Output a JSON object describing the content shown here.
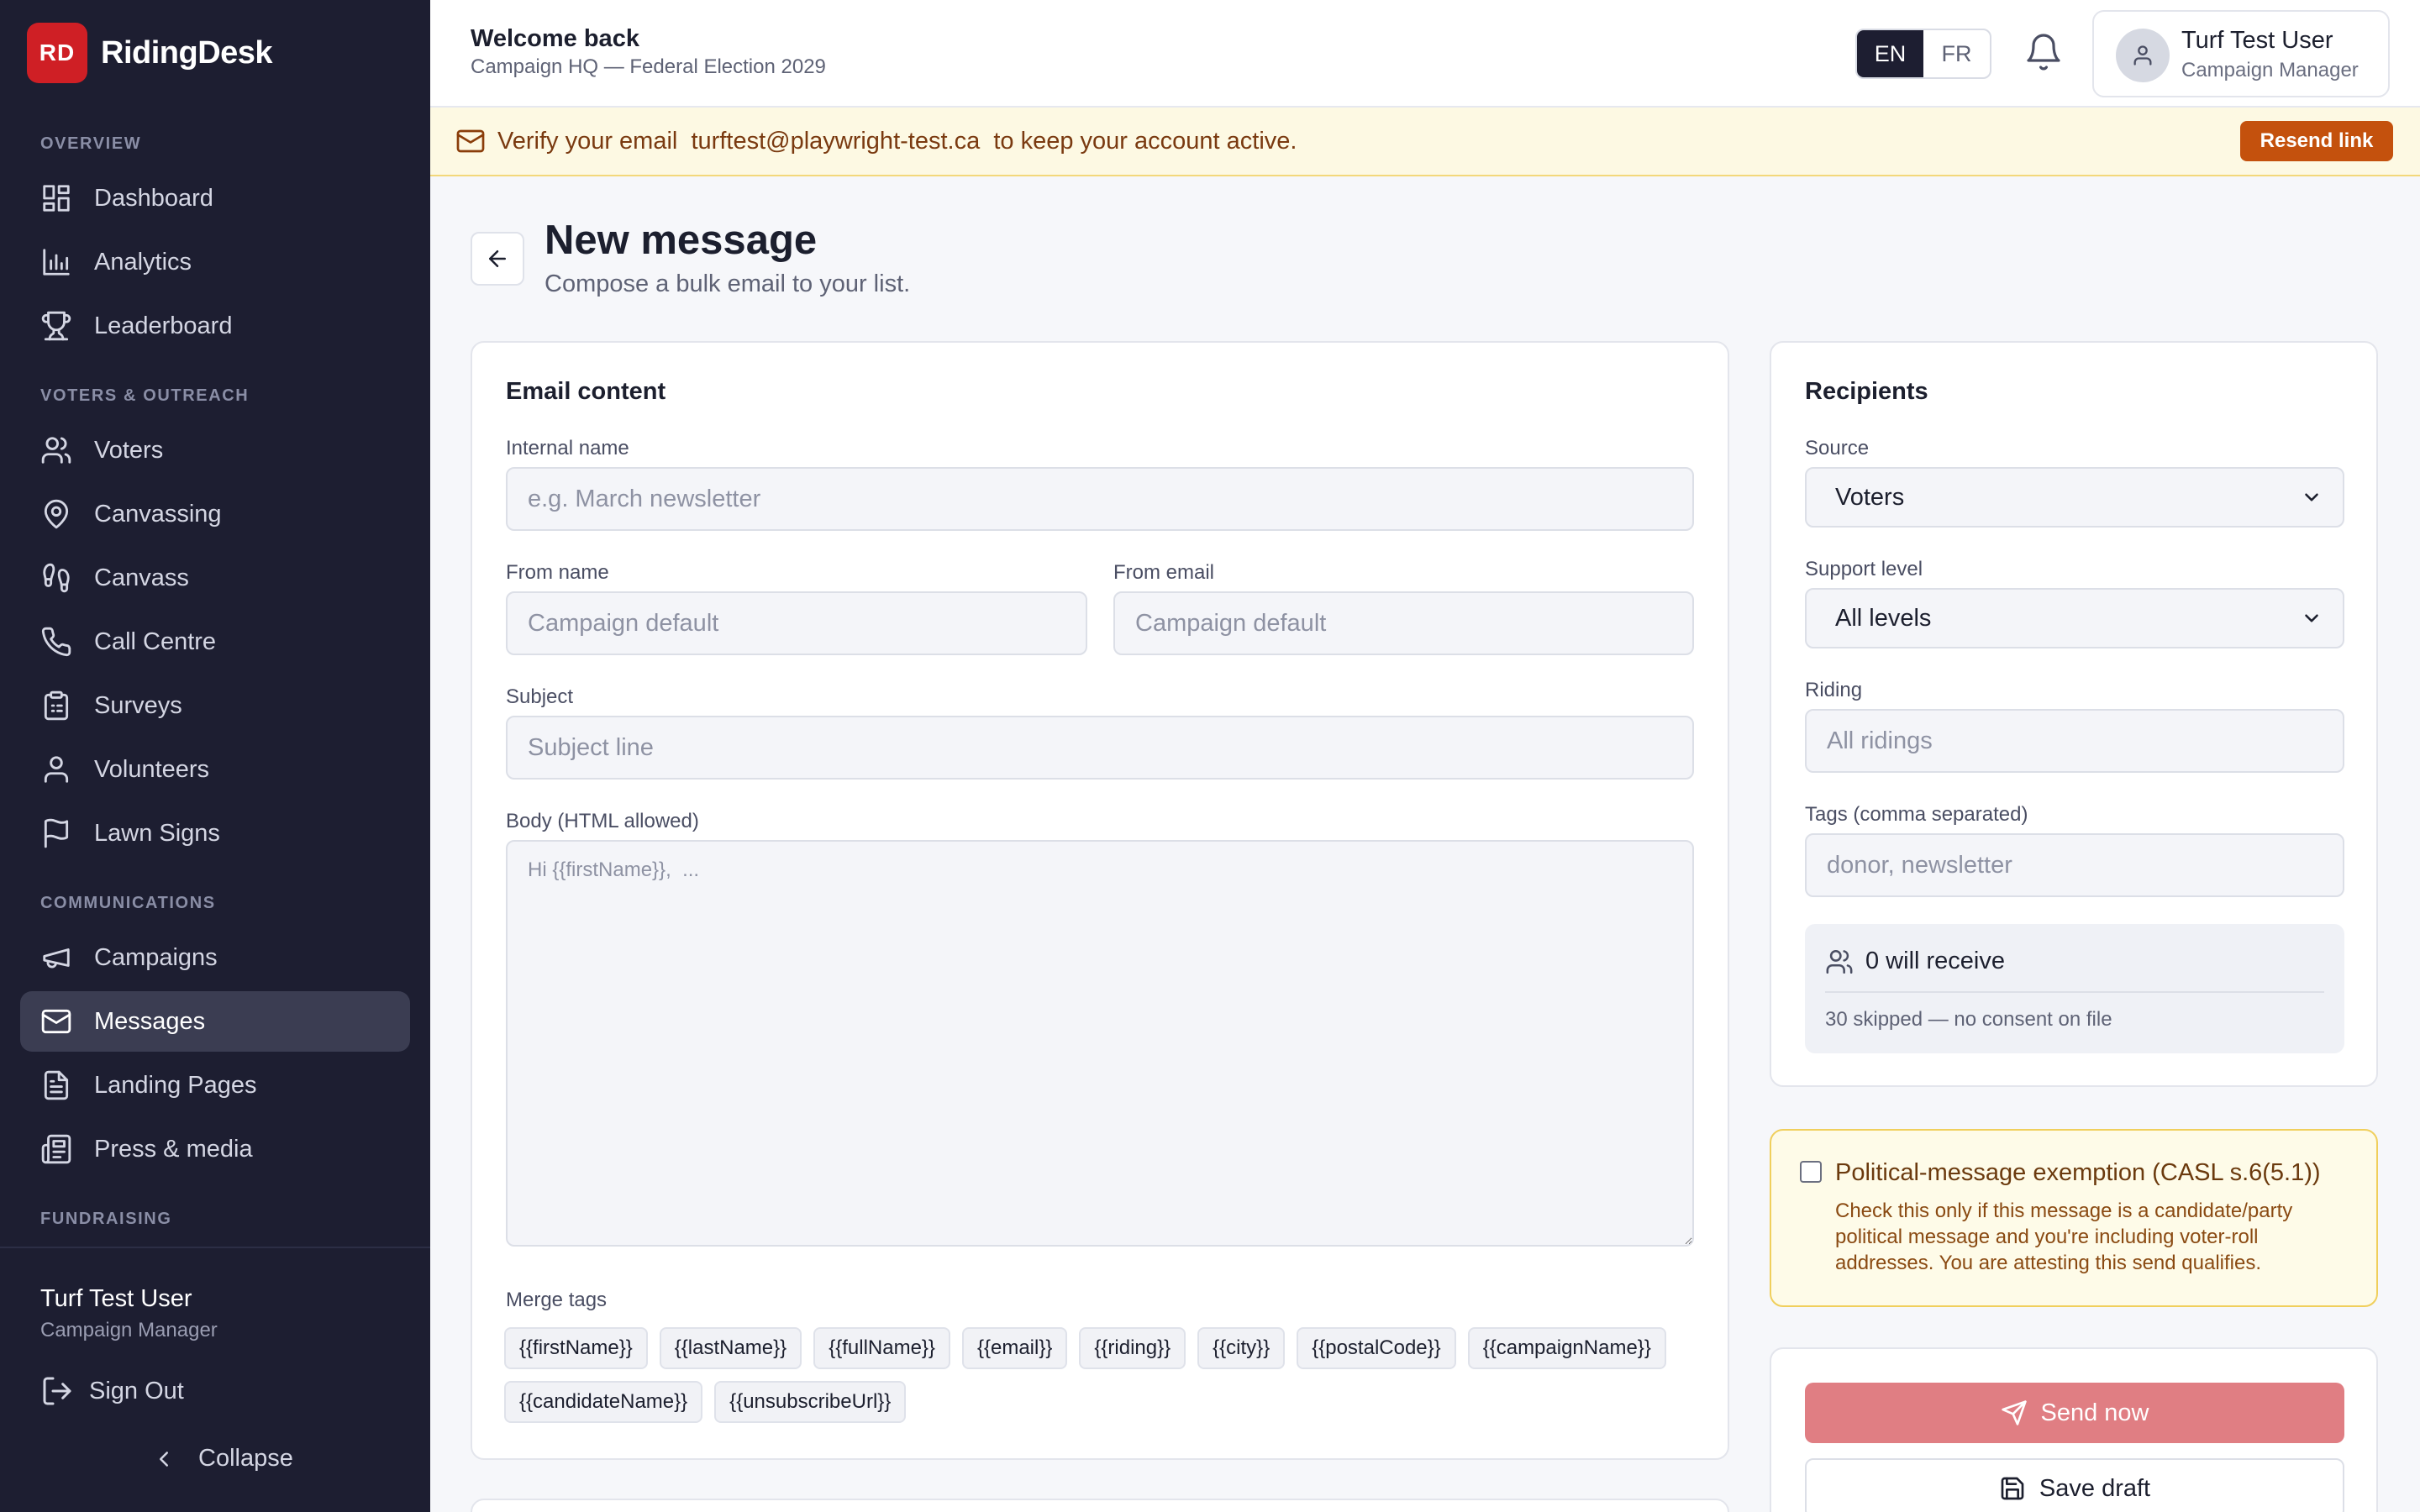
{
  "app": {
    "logo_text": "RD",
    "name": "RidingDesk"
  },
  "sidebar": {
    "sections": [
      {
        "label": "OVERVIEW"
      },
      {
        "label": "VOTERS & OUTREACH"
      },
      {
        "label": "COMMUNICATIONS"
      },
      {
        "label": "FUNDRAISING"
      }
    ],
    "items": [
      {
        "label": "Dashboard",
        "icon": "dashboard-icon"
      },
      {
        "label": "Analytics",
        "icon": "bar-chart-icon"
      },
      {
        "label": "Leaderboard",
        "icon": "trophy-icon"
      },
      {
        "label": "Voters",
        "icon": "users-icon"
      },
      {
        "label": "Canvassing",
        "icon": "map-pin-icon"
      },
      {
        "label": "Canvass",
        "icon": "footprints-icon"
      },
      {
        "label": "Call Centre",
        "icon": "phone-icon"
      },
      {
        "label": "Surveys",
        "icon": "clipboard-icon"
      },
      {
        "label": "Volunteers",
        "icon": "user-icon"
      },
      {
        "label": "Lawn Signs",
        "icon": "flag-icon"
      },
      {
        "label": "Campaigns",
        "icon": "megaphone-icon"
      },
      {
        "label": "Messages",
        "icon": "mail-icon",
        "active": true
      },
      {
        "label": "Landing Pages",
        "icon": "file-text-icon"
      },
      {
        "label": "Press & media",
        "icon": "newspaper-icon"
      }
    ],
    "user": {
      "name": "Turf Test User",
      "role": "Campaign Manager"
    },
    "sign_out_label": "Sign Out",
    "collapse_label": "Collapse"
  },
  "topbar": {
    "welcome": "Welcome back",
    "subtitle": "Campaign HQ — Federal Election 2029",
    "languages": [
      "EN",
      "FR"
    ],
    "active_language": "EN",
    "user": {
      "name": "Turf Test User",
      "role": "Campaign Manager"
    }
  },
  "banner": {
    "text_before": "Verify your email",
    "email": "turftest@playwright-test.ca",
    "text_after": "to keep your account active.",
    "button_label": "Resend link"
  },
  "page": {
    "title": "New message",
    "subtitle": "Compose a bulk email to your list."
  },
  "email_content": {
    "title": "Email content",
    "internal_name": {
      "label": "Internal name",
      "placeholder": "e.g. March newsletter",
      "value": ""
    },
    "from_name": {
      "label": "From name",
      "placeholder": "Campaign default",
      "value": ""
    },
    "from_email": {
      "label": "From email",
      "placeholder": "Campaign default",
      "value": ""
    },
    "subject": {
      "label": "Subject",
      "placeholder": "Subject line",
      "value": ""
    },
    "body": {
      "label": "Body (HTML allowed)",
      "placeholder": "Hi {{firstName}},  ...",
      "value": ""
    },
    "merge_tags_label": "Merge tags",
    "merge_tags": [
      "{{firstName}}",
      "{{lastName}}",
      "{{fullName}}",
      "{{email}}",
      "{{riding}}",
      "{{city}}",
      "{{postalCode}}",
      "{{campaignName}}",
      "{{candidateName}}",
      "{{unsubscribeUrl}}"
    ]
  },
  "recipients": {
    "title": "Recipients",
    "source": {
      "label": "Source",
      "value": "Voters"
    },
    "support_level": {
      "label": "Support level",
      "value": "All levels"
    },
    "riding": {
      "label": "Riding",
      "placeholder": "All ridings",
      "value": ""
    },
    "tags": {
      "label": "Tags (comma separated)",
      "placeholder": "donor, newsletter",
      "value": ""
    },
    "will_receive": "0 will receive",
    "skipped": "30 skipped — no consent on file"
  },
  "exemption": {
    "checked": false,
    "title": "Political-message exemption (CASL s.6(5.1))",
    "description": "Check this only if this message is a candidate/party political message and you're including voter-roll addresses. You are attesting this send qualifies."
  },
  "actions": {
    "send_label": "Send now",
    "draft_label": "Save draft"
  },
  "colors": {
    "sidebar_bg": "#1d1e31",
    "brand_red": "#cf1f25",
    "banner_bg": "#fdf9e3",
    "resend_orange": "#c4510d",
    "send_disabled": "#e07e83",
    "exemption_bg": "#fefbe8"
  }
}
